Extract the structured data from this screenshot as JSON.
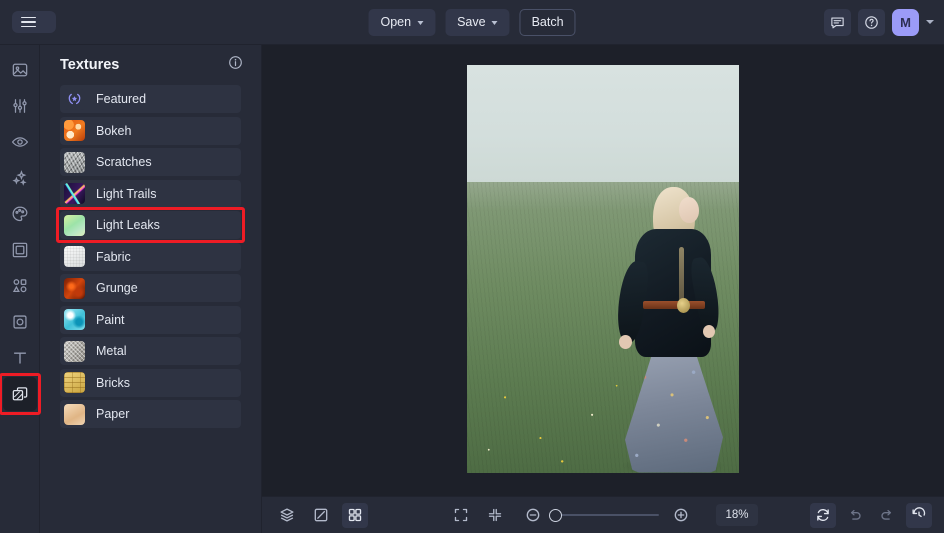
{
  "app": {
    "title": "Photo Editor",
    "accent_purple": "#9b9bf7",
    "highlight_red": "#ee1c25",
    "panel_bg": "#272b38",
    "canvas_bg": "#1d2029"
  },
  "topbar": {
    "menu_icon": "hamburger-icon",
    "open_label": "Open",
    "save_label": "Save",
    "batch_label": "Batch",
    "feedback_icon": "chat-bubble-icon",
    "help_icon": "question-circle-icon",
    "avatar_initial": "M",
    "avatar_caret_icon": "chevron-down-icon"
  },
  "rail": {
    "items": [
      {
        "name": "image",
        "icon": "image-icon",
        "active": false
      },
      {
        "name": "adjust",
        "icon": "sliders-icon",
        "active": false
      },
      {
        "name": "retouch",
        "icon": "eye-icon",
        "active": false
      },
      {
        "name": "effects",
        "icon": "sparkles-icon",
        "active": false
      },
      {
        "name": "color",
        "icon": "palette-icon",
        "active": false
      },
      {
        "name": "frames",
        "icon": "frame-icon",
        "active": false
      },
      {
        "name": "shapes",
        "icon": "shapes-icon",
        "active": false
      },
      {
        "name": "transform",
        "icon": "crop-transform-icon",
        "active": false
      },
      {
        "name": "text",
        "icon": "text-t-icon",
        "active": false
      },
      {
        "name": "textures",
        "icon": "layers-texture-icon",
        "active": true
      }
    ]
  },
  "panel": {
    "title": "Textures",
    "info_icon": "info-circle-icon",
    "items": [
      {
        "label": "Featured",
        "thumb": "th-featured",
        "icon": "laurel-award-icon",
        "highlighted": false
      },
      {
        "label": "Bokeh",
        "thumb": "th-bokeh",
        "highlighted": false
      },
      {
        "label": "Scratches",
        "thumb": "th-scratches",
        "highlighted": false
      },
      {
        "label": "Light Trails",
        "thumb": "th-lighttrails",
        "highlighted": false
      },
      {
        "label": "Light Leaks",
        "thumb": "th-lightleaks",
        "highlighted": true
      },
      {
        "label": "Fabric",
        "thumb": "th-fabric",
        "highlighted": false
      },
      {
        "label": "Grunge",
        "thumb": "th-grunge",
        "highlighted": false
      },
      {
        "label": "Paint",
        "thumb": "th-paint",
        "highlighted": false
      },
      {
        "label": "Metal",
        "thumb": "th-metal",
        "highlighted": false
      },
      {
        "label": "Bricks",
        "thumb": "th-bricks",
        "highlighted": false
      },
      {
        "label": "Paper",
        "thumb": "th-paper",
        "highlighted": false
      }
    ]
  },
  "canvas": {
    "photo_alt": "Blonde woman in dark velvet blazer and floral skirt walking through a green grassy field under an overcast sky"
  },
  "bottombar": {
    "layers_icon": "layers-icon",
    "compare_icon": "compare-split-icon",
    "grid_icon": "grid-view-icon",
    "fit_icon": "fit-to-screen-icon",
    "shrink_icon": "shrink-collapse-icon",
    "zoom_out_icon": "minus-circle-icon",
    "zoom_in_icon": "plus-circle-icon",
    "zoom_level": "18%",
    "reset_icon": "reset-refresh-icon",
    "undo_icon": "undo-arrow-icon",
    "redo_icon": "redo-arrow-icon",
    "history_icon": "history-clock-icon"
  }
}
